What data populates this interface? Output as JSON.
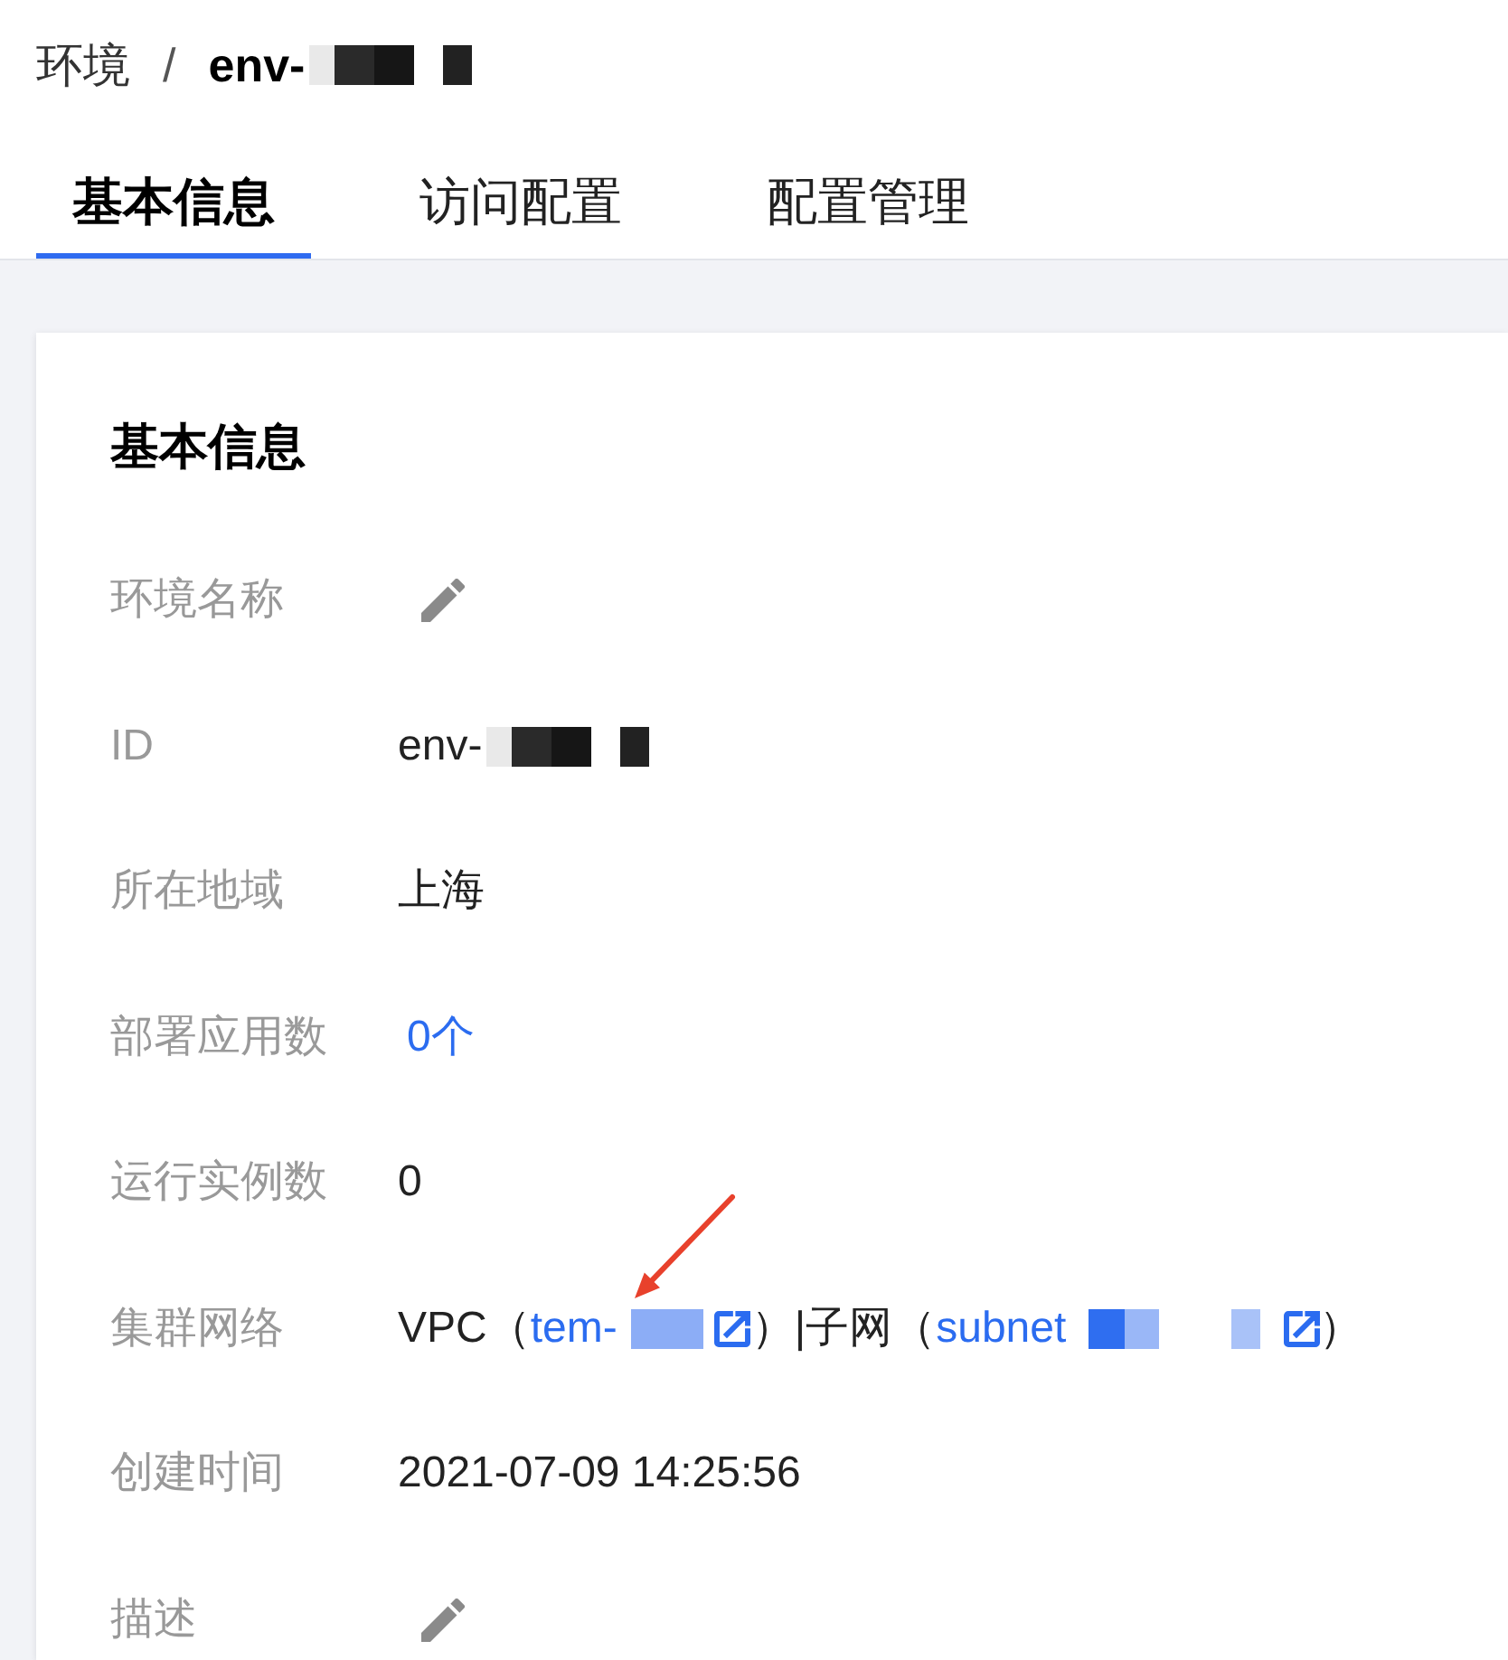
{
  "breadcrumb": {
    "parent": "环境",
    "separator": "/",
    "current": {
      "text": "env-",
      "redacted": true
    }
  },
  "tabs": [
    {
      "label": "基本信息",
      "selected": true
    },
    {
      "label": "访问配置",
      "selected": false
    },
    {
      "label": "配置管理",
      "selected": false
    }
  ],
  "card": {
    "title": "基本信息",
    "fields": [
      {
        "label": "环境名称",
        "kind": "editable"
      },
      {
        "label": "ID",
        "kind": "text",
        "value": "env-",
        "redacted": true
      },
      {
        "label": "所在地域",
        "kind": "text",
        "value": "上海"
      },
      {
        "label": "部署应用数",
        "kind": "link",
        "value": "0个"
      },
      {
        "label": "运行实例数",
        "kind": "text",
        "value": "0"
      },
      {
        "label": "集群网络",
        "kind": "network",
        "parts": [
          {
            "kind": "text",
            "text": "VPC（"
          },
          {
            "kind": "link",
            "text": "tem-",
            "redacted": true,
            "external": true
          },
          {
            "kind": "text",
            "text": "）|子网（"
          },
          {
            "kind": "link",
            "text": "subnet",
            "redacted": true,
            "external": true
          },
          {
            "kind": "text",
            "text": "）"
          }
        ]
      },
      {
        "label": "创建时间",
        "kind": "text",
        "value": "2021-07-09 14:25:56"
      },
      {
        "label": "描述",
        "kind": "editable"
      }
    ]
  },
  "annotations": [
    {
      "kind": "arrow"
    }
  ]
}
